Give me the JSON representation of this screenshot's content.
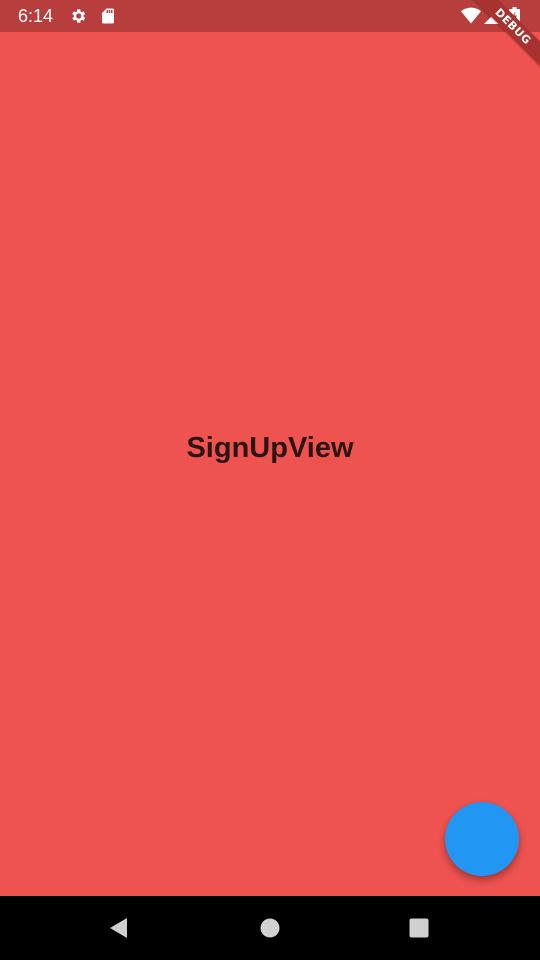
{
  "status_bar": {
    "time": "6:14",
    "icons": [
      "gear-icon",
      "sd-card-icon",
      "wifi-icon",
      "signal-icon",
      "battery-icon"
    ]
  },
  "debug_banner": {
    "label": "DEBUG"
  },
  "main": {
    "title": "SignUpView"
  },
  "fab": {
    "icon": "none"
  },
  "nav_bar": {
    "buttons": [
      "back-icon",
      "home-icon",
      "recents-icon"
    ]
  },
  "colors": {
    "background": "#EF5350",
    "status_bar": "#B73E3C",
    "fab": "#2196F3",
    "nav_bar": "#000000",
    "title_text": "#2a1414"
  }
}
